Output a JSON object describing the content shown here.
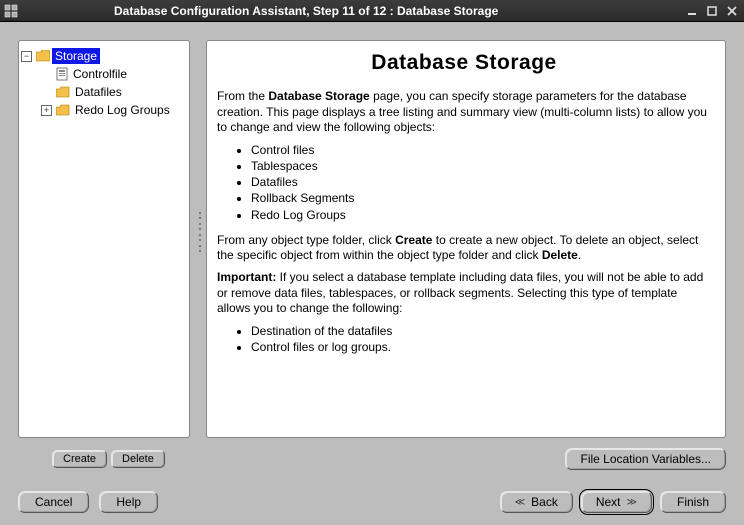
{
  "window": {
    "title": "Database Configuration Assistant, Step 11 of 12 : Database Storage"
  },
  "tree": {
    "root": {
      "label": "Storage"
    },
    "children": {
      "controlfile": "Controlfile",
      "datafiles": "Datafiles",
      "redolog": "Redo Log Groups"
    }
  },
  "page": {
    "heading": "Database Storage",
    "p1_pre": "From the ",
    "p1_bold": "Database Storage",
    "p1_post": " page, you can specify storage parameters for the database creation. This page displays a tree listing and summary view (multi-column lists) to allow you to change and view the following objects:",
    "list1": {
      "i0": "Control files",
      "i1": "Tablespaces",
      "i2": "Datafiles",
      "i3": "Rollback Segments",
      "i4": "Redo Log Groups"
    },
    "p2_a": "From any object type folder, click ",
    "p2_b": "Create",
    "p2_c": " to create a new object. To delete an object, select the specific object from within the object type folder and click ",
    "p2_d": "Delete",
    "p2_e": ".",
    "p3_a": "Important:",
    "p3_b": " If you select a database template including data files, you will not be able to add or remove data files, tablespaces, or rollback segments. Selecting this type of template allows you to change the following:",
    "list2": {
      "i0": "Destination of the datafiles",
      "i1": "Control files or log groups."
    }
  },
  "buttons": {
    "create": "Create",
    "delete": "Delete",
    "file_loc": "File Location Variables...",
    "cancel": "Cancel",
    "help": "Help",
    "back": "Back",
    "next": "Next",
    "finish": "Finish"
  }
}
